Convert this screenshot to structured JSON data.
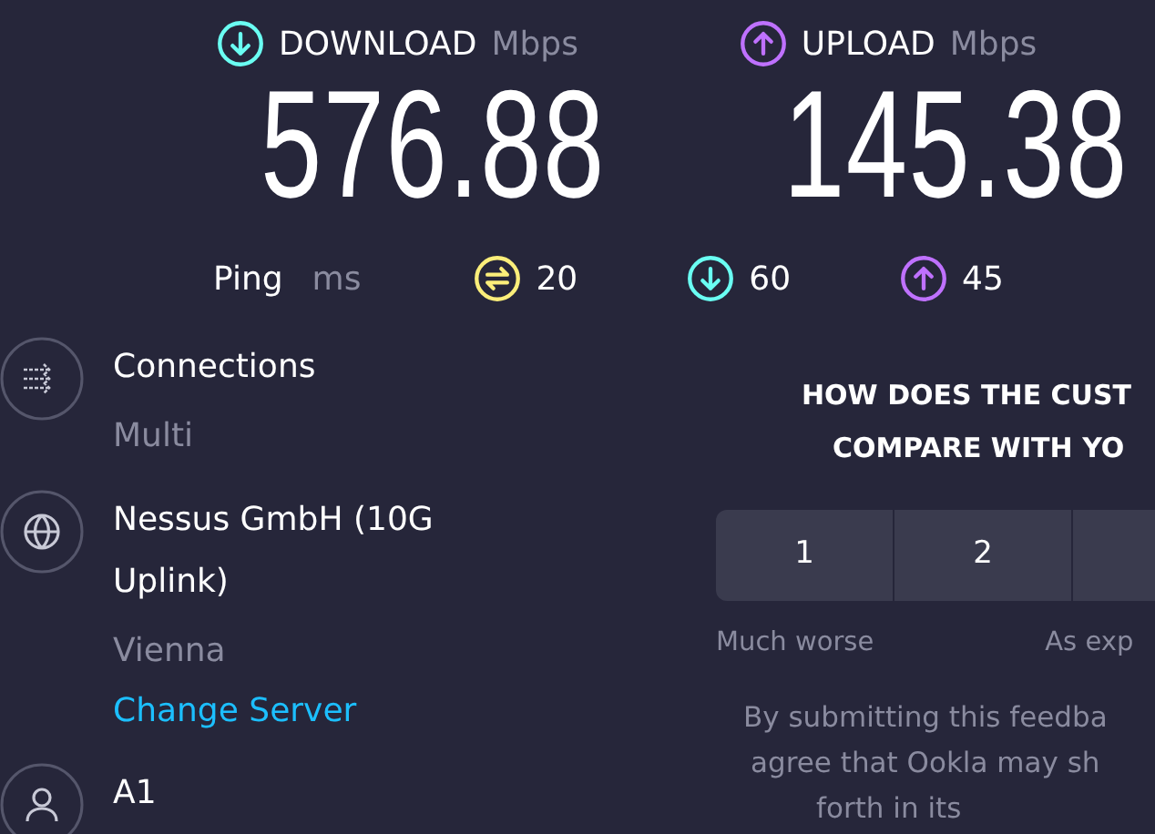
{
  "metrics": [
    {
      "kind": "download",
      "label": "DOWNLOAD",
      "unit": "Mbps",
      "value": "576.88"
    },
    {
      "kind": "upload",
      "label": "UPLOAD",
      "unit": "Mbps",
      "value": "145.38"
    }
  ],
  "ping": {
    "label": "Ping",
    "unit": "ms",
    "readings": [
      {
        "kind": "idle",
        "value": "20"
      },
      {
        "kind": "download",
        "value": "60"
      },
      {
        "kind": "upload",
        "value": "45"
      }
    ]
  },
  "details": [
    {
      "kind": "connections",
      "title": "Connections",
      "subtitle": "Multi"
    },
    {
      "kind": "server",
      "title": "Nessus GmbH (10G Uplink)",
      "subtitle": "Vienna",
      "link": "Change Server"
    },
    {
      "kind": "provider",
      "title": "A1"
    }
  ],
  "feedback": {
    "question_lines": [
      "HOW DOES THE CUST",
      "COMPARE WITH YO"
    ],
    "ratings": [
      {
        "label": "1"
      },
      {
        "label": "2"
      }
    ],
    "cut_off_button": true,
    "scale_labels": [
      "Much worse",
      "As exp"
    ],
    "notice_lines": [
      "By submitting this feedba",
      "agree that Ookla may sh",
      "forth in its"
    ]
  }
}
